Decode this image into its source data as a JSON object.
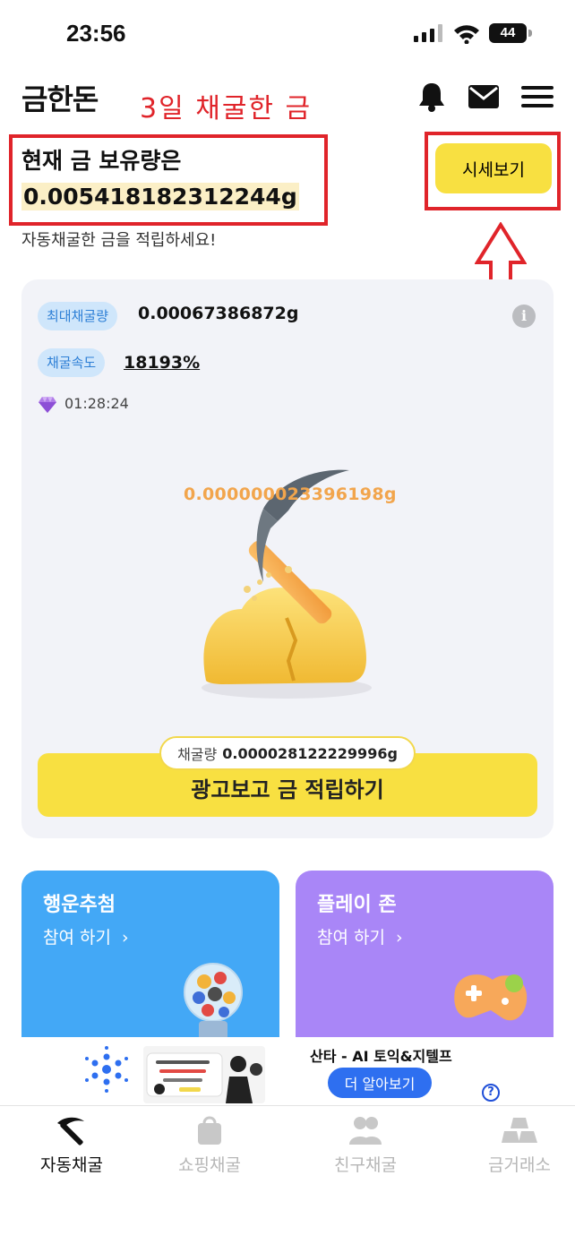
{
  "status_bar": {
    "time": "23:56",
    "battery": "44"
  },
  "header": {
    "logo": "금한돈",
    "annotation": "3일 채굴한 금"
  },
  "holdings": {
    "label": "현재 금 보유량은",
    "value": "0.005418182312244g",
    "subtitle": "자동채굴한 금을 적립하세요!",
    "price_button": "시세보기"
  },
  "mining": {
    "max_label": "최대채굴량",
    "max_value": "0.00067386872g",
    "speed_label": "채굴속도",
    "speed_value": "18193%",
    "timer": "01:28:24",
    "current_amount": "0.000000023396198g",
    "mined_label": "채굴량",
    "mined_value": "0.000028122229996g",
    "ad_button": "광고보고 금 적립하기"
  },
  "cards": [
    {
      "title": "행운추첨",
      "cta": "참여 하기",
      "color": "#43a8f6"
    },
    {
      "title": "플레이 존",
      "cta": "참여 하기",
      "color": "#a986f7"
    }
  ],
  "ad": {
    "title": "산타 - AI 토익&지텔프",
    "cta": "더 알아보기",
    "help": "?"
  },
  "nav": [
    {
      "label": "자동채굴",
      "icon": "pickaxe-icon",
      "active": true
    },
    {
      "label": "쇼핑채굴",
      "icon": "shopping-bag-icon",
      "active": false
    },
    {
      "label": "친구채굴",
      "icon": "friends-icon",
      "active": false
    },
    {
      "label": "금거래소",
      "icon": "gold-bars-icon",
      "active": false
    }
  ],
  "colors": {
    "accent_yellow": "#f8e041",
    "annotation_red": "#e0242a",
    "badge_blue": "#2d7fd6"
  }
}
